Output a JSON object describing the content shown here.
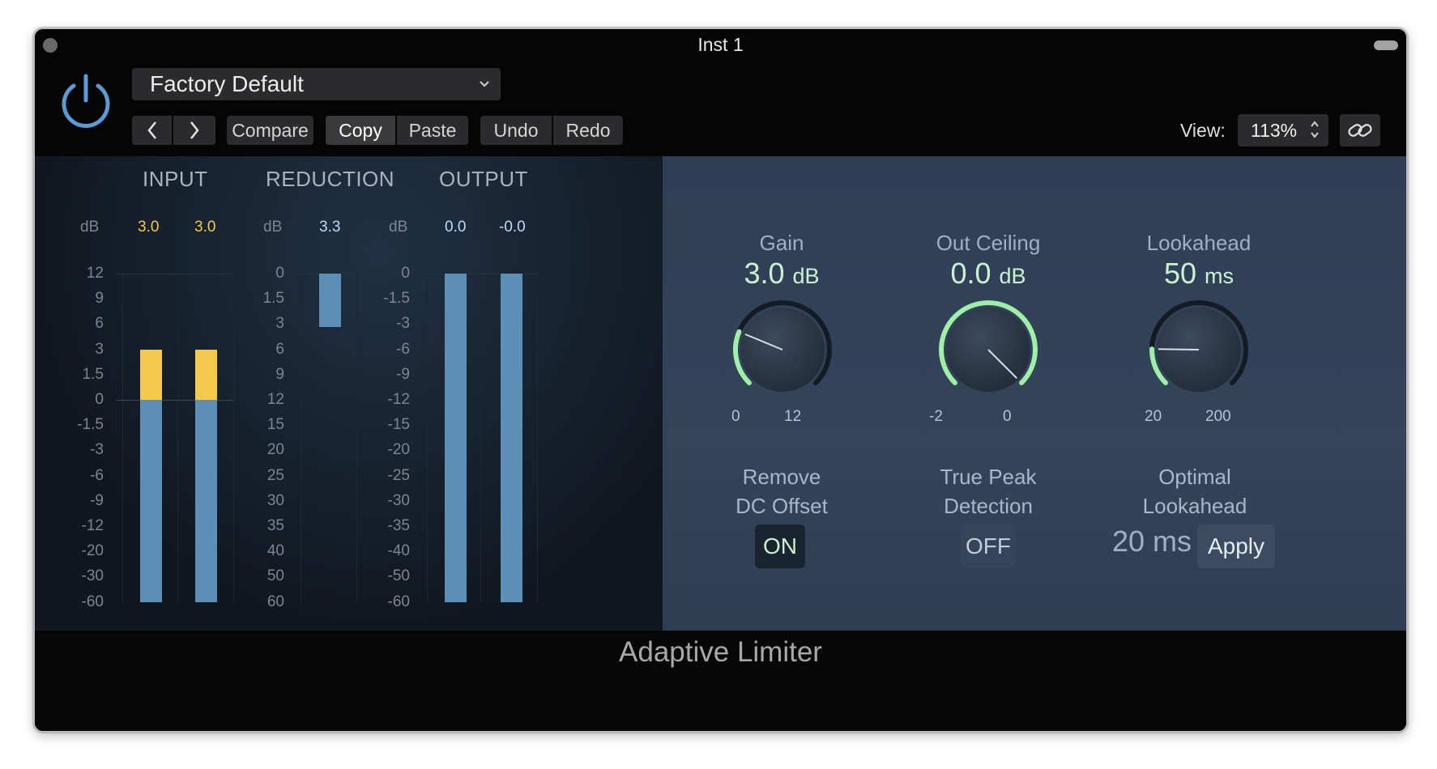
{
  "window": {
    "title": "Inst 1"
  },
  "toolbar": {
    "preset": "Factory Default",
    "compare": "Compare",
    "copy": "Copy",
    "paste": "Paste",
    "undo": "Undo",
    "redo": "Redo",
    "view_label": "View:",
    "view_value": "113%"
  },
  "meters": {
    "input": {
      "label": "INPUT",
      "unit": "dB",
      "values": [
        "3.0",
        "3.0"
      ],
      "scale": [
        "12",
        "9",
        "6",
        "3",
        "1.5",
        "0",
        "-1.5",
        "-3",
        "-6",
        "-9",
        "-12",
        "-20",
        "-30",
        "-60"
      ],
      "levels_db": [
        3.0,
        3.0
      ]
    },
    "reduction": {
      "label": "REDUCTION",
      "unit": "dB",
      "value": "3.3",
      "scale": [
        "0",
        "1.5",
        "3",
        "6",
        "9",
        "12",
        "15",
        "20",
        "25",
        "30",
        "35",
        "40",
        "50",
        "60"
      ],
      "level_db": 3.3
    },
    "output": {
      "label": "OUTPUT",
      "unit": "dB",
      "values": [
        "0.0",
        "-0.0"
      ],
      "scale": [
        "0",
        "-1.5",
        "-3",
        "-6",
        "-9",
        "-12",
        "-15",
        "-20",
        "-25",
        "-30",
        "-35",
        "-40",
        "-50",
        "-60"
      ],
      "levels_db": [
        0.0,
        -0.0
      ]
    },
    "colors": {
      "bar": "#5b8fb8",
      "clip": "#f2c94c",
      "input_value": "#f2c94c",
      "value": "#b8dcf6"
    }
  },
  "controls": {
    "gain": {
      "label": "Gain",
      "value": "3.0",
      "unit": "dB",
      "min": "0",
      "max": "12",
      "fraction": 0.25
    },
    "out_ceiling": {
      "label": "Out Ceiling",
      "value": "0.0",
      "unit": "dB",
      "min": "-2",
      "max": "0",
      "fraction": 1.0
    },
    "lookahead": {
      "label": "Lookahead",
      "value": "50",
      "unit": "ms",
      "min": "20",
      "max": "200",
      "fraction": 0.17
    },
    "remove_dc": {
      "label_line1": "Remove",
      "label_line2": "DC Offset",
      "state": "ON"
    },
    "true_peak": {
      "label_line1": "True Peak",
      "label_line2": "Detection",
      "state": "OFF"
    },
    "optimal_lookahead": {
      "label_line1": "Optimal",
      "label_line2": "Lookahead",
      "value": "20 ms",
      "button": "Apply"
    },
    "colors": {
      "accent": "#9df0a6",
      "value_text": "#c9f3cc"
    }
  },
  "footer": {
    "plugin_name": "Adaptive Limiter"
  }
}
